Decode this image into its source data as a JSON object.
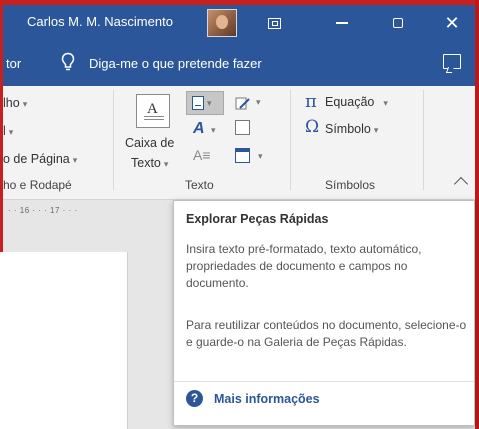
{
  "titlebar": {
    "user_name": "Carlos M. M. Nascimento",
    "close_glyph": "✕"
  },
  "tellbar": {
    "tab_partial": "tor",
    "tell_me_placeholder": "Diga-me o que pretende fazer"
  },
  "ribbon": {
    "cabecalho_partial": "lho",
    "numero_partial": "l",
    "numero_pagina_partial": "o de Página",
    "group_cabecalho_partial": "ho e Rodapé",
    "textbox_line1": "Caixa de",
    "textbox_line2": "Texto",
    "group_texto": "Texto",
    "equacao": "Equação",
    "simbolo": "Símbolo",
    "group_simbolos": "Símbolos",
    "pi_glyph": "π",
    "omega_glyph": "Ω"
  },
  "ruler": {
    "marks": "· · 16 · · · 17 · · ·"
  },
  "tooltip": {
    "title": "Explorar Peças Rápidas",
    "paragraph1": "Insira texto pré-formatado, texto automático, propriedades de documento e campos no documento.",
    "paragraph2": "Para reutilizar conteúdos no documento, selecione-o e guarde-o na Galeria de Peças Rápidas.",
    "more_info": "Mais informações",
    "help_glyph": "?"
  },
  "colors": {
    "word_blue": "#2b579a",
    "frame_red": "#c8201e"
  }
}
